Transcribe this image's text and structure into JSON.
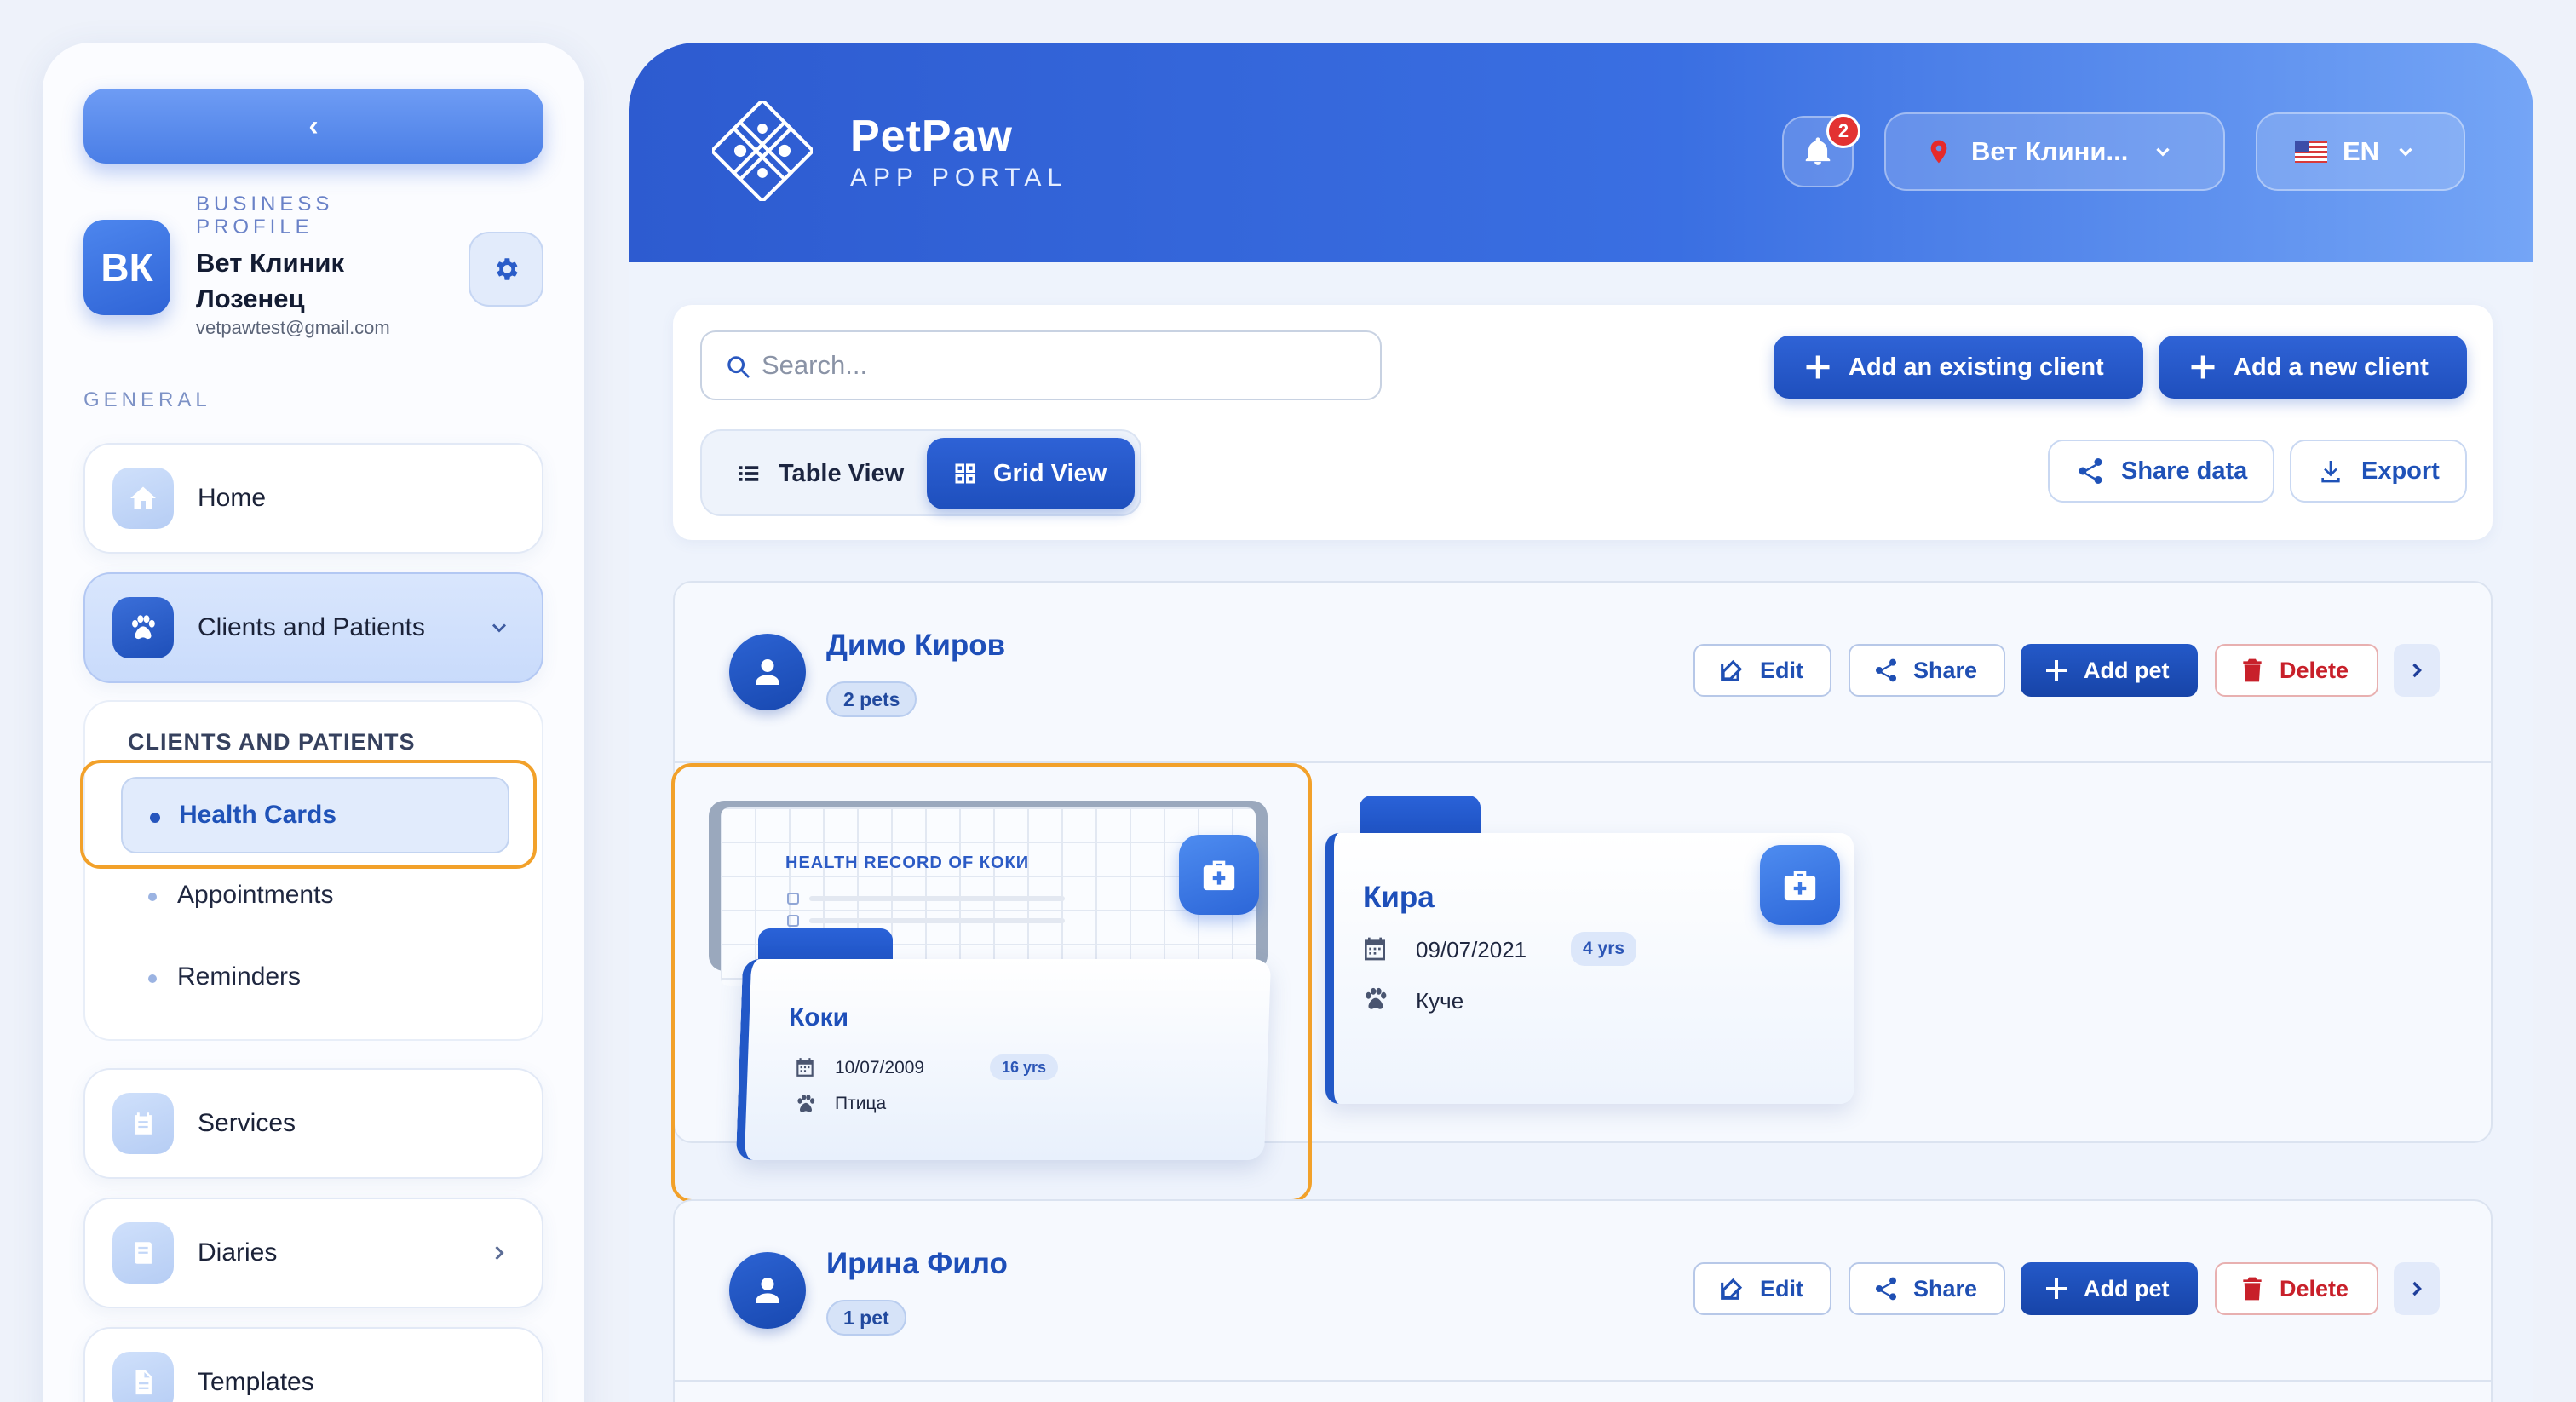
{
  "sidebar": {
    "collapse_glyph": "‹",
    "profile": {
      "initials": "ВК",
      "label": "BUSINESS PROFILE",
      "name": "Вет Клиник Лозенец",
      "email": "vetpawtest@gmail.com"
    },
    "general_heading": "GENERAL",
    "nav": {
      "home": "Home",
      "clients": "Clients and Patients",
      "services": "Services",
      "diaries": "Diaries",
      "templates": "Templates"
    },
    "submenu": {
      "title": "CLIENTS AND PATIENTS",
      "items": [
        "Health Cards",
        "Appointments",
        "Reminders"
      ],
      "active": "Health Cards"
    }
  },
  "header": {
    "brand": "PetPaw",
    "subtitle": "APP PORTAL",
    "notifications_count": "2",
    "clinic": "Вет Клини...",
    "language": "EN",
    "flag": "us-flag-icon"
  },
  "toolbar": {
    "search_placeholder": "Search...",
    "table_view": "Table View",
    "grid_view": "Grid View",
    "active_view": "Grid View",
    "add_existing": "Add an existing client",
    "add_new": "Add a new client",
    "share_data": "Share data",
    "export": "Export"
  },
  "actions": {
    "edit": "Edit",
    "share": "Share",
    "add_pet": "Add pet",
    "delete": "Delete"
  },
  "clients": [
    {
      "name": "Димо Киров",
      "pets_badge": "2 pets",
      "pets": [
        {
          "record_title": "HEALTH RECORD OF КОКИ",
          "name": "Коки",
          "dob": "10/07/2009",
          "age": "16 yrs",
          "species": "Птица"
        },
        {
          "name": "Кира",
          "dob": "09/07/2021",
          "age": "4 yrs",
          "species": "Куче"
        }
      ]
    },
    {
      "name": "Ирина Фило",
      "pets_badge": "1 pet"
    }
  ],
  "colors": {
    "primary": "#1f4fbd",
    "accent_highlight": "#f2a12a",
    "danger": "#c8202a",
    "badge": "#e33232"
  }
}
